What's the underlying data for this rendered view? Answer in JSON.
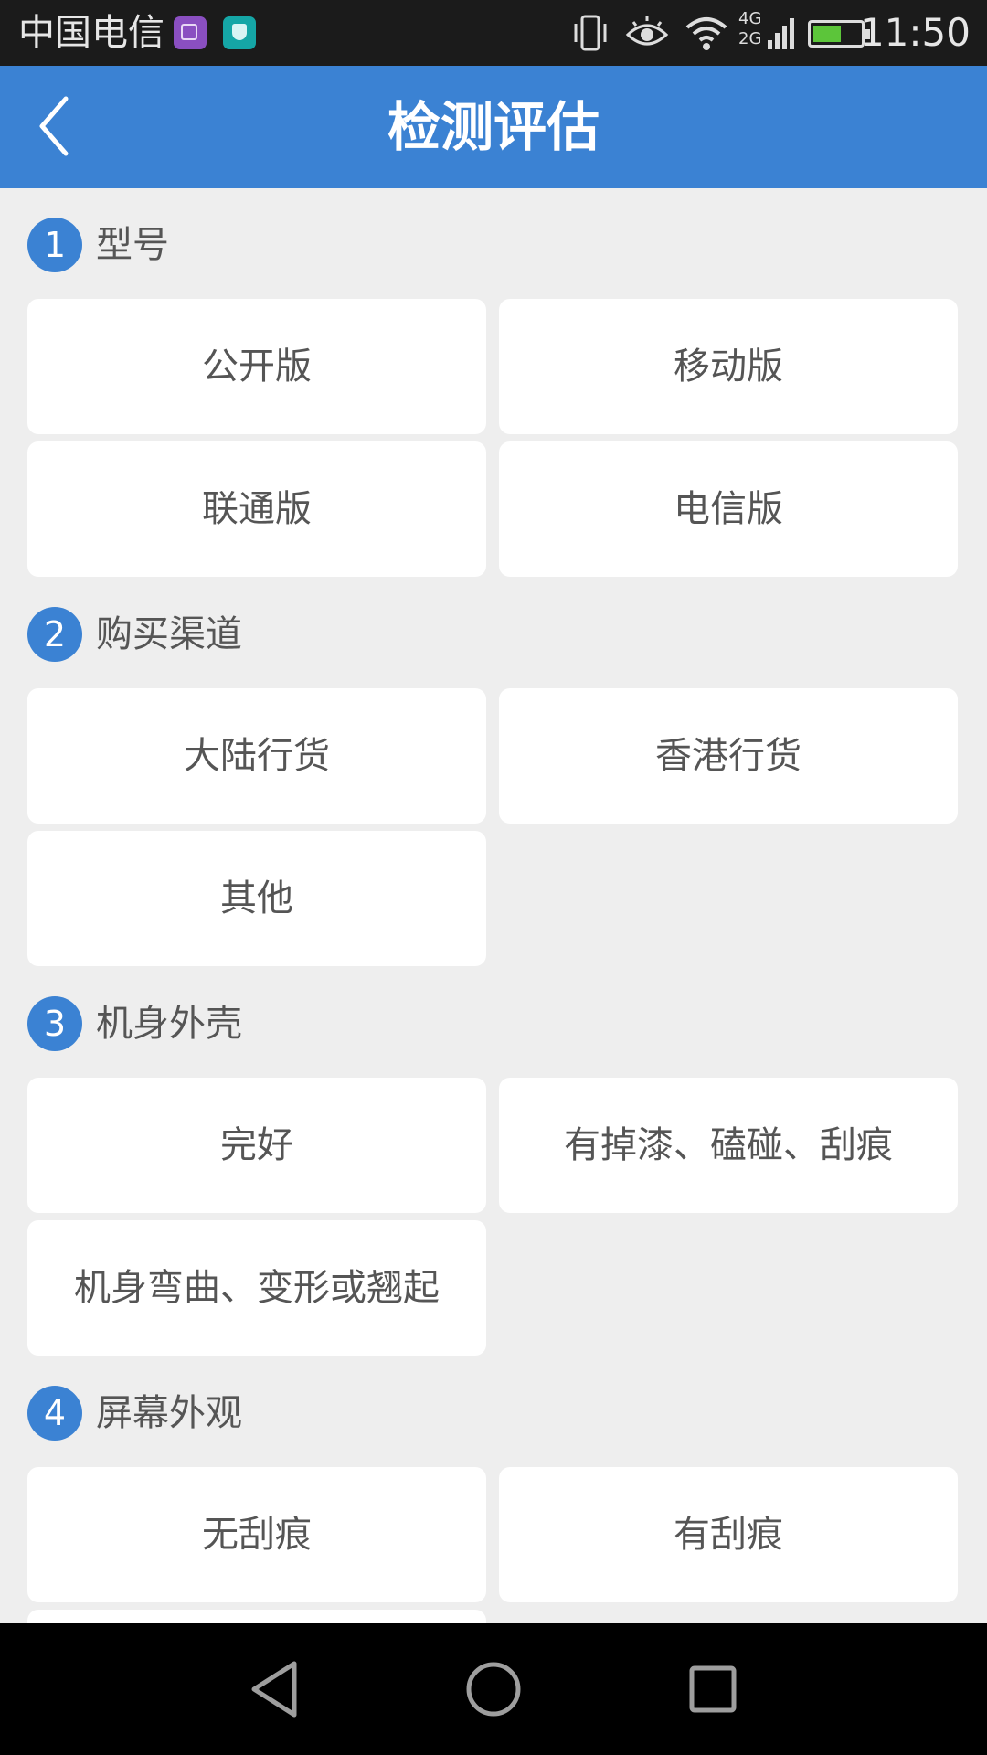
{
  "status_bar": {
    "carrier": "中国电信",
    "time": "11:50",
    "network_top": "4G",
    "network_bottom": "2G",
    "icons": [
      "gallery-app-icon",
      "security-app-icon",
      "vibrate-icon",
      "eye-comfort-icon",
      "wifi-icon",
      "signal-icon",
      "battery-charging-icon"
    ]
  },
  "header": {
    "title": "检测评估",
    "back_icon": "chevron-left-icon"
  },
  "sections": [
    {
      "num": "1",
      "title": "型号",
      "options": [
        "公开版",
        "移动版",
        "联通版",
        "电信版"
      ]
    },
    {
      "num": "2",
      "title": "购买渠道",
      "options": [
        "大陆行货",
        "香港行货",
        "其他"
      ]
    },
    {
      "num": "3",
      "title": "机身外壳",
      "options": [
        "完好",
        "有掉漆、磕碰、刮痕",
        "机身弯曲、变形或翘起"
      ]
    },
    {
      "num": "4",
      "title": "屏幕外观",
      "options": [
        "无刮痕",
        "有刮痕"
      ]
    }
  ],
  "nav_bar": {
    "icons": [
      "back-triangle-icon",
      "home-circle-icon",
      "recents-square-icon"
    ]
  },
  "colors": {
    "accent": "#3b82d3",
    "background": "#eeeeee",
    "card": "#ffffff"
  }
}
